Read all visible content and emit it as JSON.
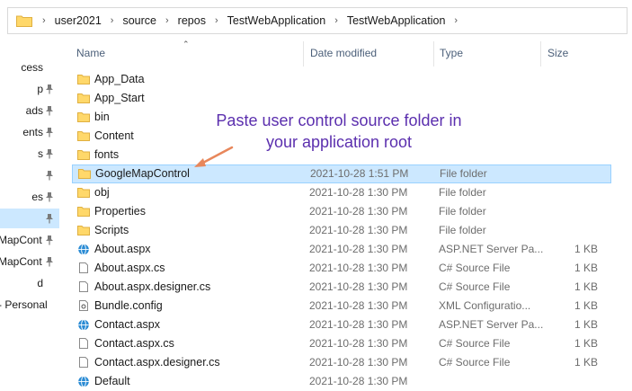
{
  "address_bar": {
    "crumbs": [
      "user2021",
      "source",
      "repos",
      "TestWebApplication",
      "TestWebApplication"
    ]
  },
  "nav_pane": {
    "items": [
      {
        "label": "cess",
        "pinned": false,
        "selected": false
      },
      {
        "label": "p",
        "pinned": true,
        "selected": false
      },
      {
        "label": "ads",
        "pinned": true,
        "selected": false
      },
      {
        "label": "ents",
        "pinned": true,
        "selected": false
      },
      {
        "label": "s",
        "pinned": true,
        "selected": false
      },
      {
        "label": "",
        "pinned": true,
        "selected": false
      },
      {
        "label": "es",
        "pinned": true,
        "selected": false
      },
      {
        "label": "",
        "pinned": true,
        "selected": true
      },
      {
        "label": "MapCont",
        "pinned": true,
        "selected": false
      },
      {
        "label": "MapCont",
        "pinned": true,
        "selected": false
      },
      {
        "label": "d",
        "pinned": false,
        "selected": false
      },
      {
        "label": "- Personal",
        "pinned": false,
        "selected": false
      }
    ]
  },
  "columns": {
    "name": "Name",
    "date_modified": "Date modified",
    "type": "Type",
    "size": "Size"
  },
  "files": [
    {
      "name": "App_Data",
      "date": "",
      "type": "",
      "size": "",
      "icon": "folder-icon",
      "selected": false
    },
    {
      "name": "App_Start",
      "date": "",
      "type": "",
      "size": "",
      "icon": "folder-icon",
      "selected": false
    },
    {
      "name": "bin",
      "date": "",
      "type": "",
      "size": "",
      "icon": "folder-icon",
      "selected": false
    },
    {
      "name": "Content",
      "date": "",
      "type": "",
      "size": "",
      "icon": "folder-icon",
      "selected": false
    },
    {
      "name": "fonts",
      "date": "",
      "type": "",
      "size": "",
      "icon": "folder-icon",
      "selected": false
    },
    {
      "name": "GoogleMapControl",
      "date": "2021-10-28 1:51 PM",
      "type": "File folder",
      "size": "",
      "icon": "folder-icon",
      "selected": true
    },
    {
      "name": "obj",
      "date": "2021-10-28 1:30 PM",
      "type": "File folder",
      "size": "",
      "icon": "folder-icon",
      "selected": false
    },
    {
      "name": "Properties",
      "date": "2021-10-28 1:30 PM",
      "type": "File folder",
      "size": "",
      "icon": "folder-icon",
      "selected": false
    },
    {
      "name": "Scripts",
      "date": "2021-10-28 1:30 PM",
      "type": "File folder",
      "size": "",
      "icon": "folder-icon",
      "selected": false
    },
    {
      "name": "About.aspx",
      "date": "2021-10-28 1:30 PM",
      "type": "ASP.NET Server Pa...",
      "size": "1 KB",
      "icon": "globe-icon",
      "selected": false
    },
    {
      "name": "About.aspx.cs",
      "date": "2021-10-28 1:30 PM",
      "type": "C# Source File",
      "size": "1 KB",
      "icon": "file-icon",
      "selected": false
    },
    {
      "name": "About.aspx.designer.cs",
      "date": "2021-10-28 1:30 PM",
      "type": "C# Source File",
      "size": "1 KB",
      "icon": "file-icon",
      "selected": false
    },
    {
      "name": "Bundle.config",
      "date": "2021-10-28 1:30 PM",
      "type": "XML Configuratio...",
      "size": "1 KB",
      "icon": "config-file-icon",
      "selected": false
    },
    {
      "name": "Contact.aspx",
      "date": "2021-10-28 1:30 PM",
      "type": "ASP.NET Server Pa...",
      "size": "1 KB",
      "icon": "globe-icon",
      "selected": false
    },
    {
      "name": "Contact.aspx.cs",
      "date": "2021-10-28 1:30 PM",
      "type": "C# Source File",
      "size": "1 KB",
      "icon": "file-icon",
      "selected": false
    },
    {
      "name": "Contact.aspx.designer.cs",
      "date": "2021-10-28 1:30 PM",
      "type": "C# Source File",
      "size": "1 KB",
      "icon": "file-icon",
      "selected": false
    },
    {
      "name": "Default",
      "date": "2021-10-28 1:30 PM",
      "type": "",
      "size": "",
      "icon": "globe-icon",
      "selected": false
    }
  ],
  "annotation": {
    "line1": "Paste user control source folder in",
    "line2": "your application root"
  },
  "colors": {
    "selection_bg": "#cce8ff",
    "selection_border": "#99d1ff",
    "folder": "#ffd86a",
    "annotation_text": "#5b2fae",
    "arrow": "#e8875b"
  }
}
